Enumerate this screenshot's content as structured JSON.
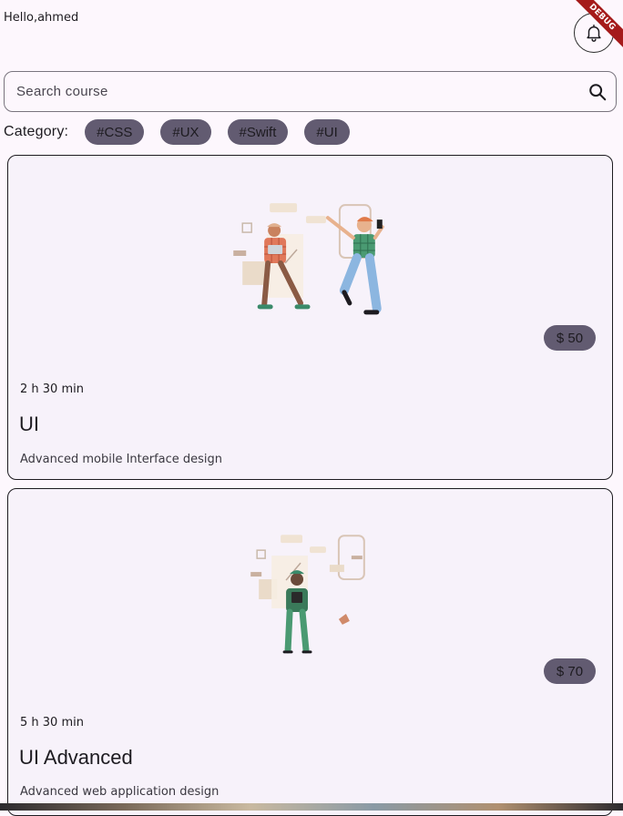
{
  "header": {
    "greeting": "Hello,ahmed",
    "bell_icon": "bell-icon",
    "debug_label": "DEBUG"
  },
  "search": {
    "placeholder": "Search course",
    "value": "",
    "icon": "search-icon"
  },
  "category": {
    "label": "Category:",
    "chips": [
      "#CSS",
      "#UX",
      "#Swift",
      "#UI"
    ]
  },
  "courses": [
    {
      "price": "$ 50",
      "duration": "2 h 30 min",
      "title": "UI",
      "description": "Advanced mobile Interface design",
      "illustration": "two-people-designing-illustration"
    },
    {
      "price": "$ 70",
      "duration": "5 h 30 min",
      "title": "UI Advanced",
      "description": "Advanced web application design",
      "illustration": "person-with-phone-illustration"
    }
  ],
  "colors": {
    "background": "#fdf7fd",
    "card": "#f7f2fa",
    "chip": "#625b71",
    "debug": "#a51b1b"
  }
}
